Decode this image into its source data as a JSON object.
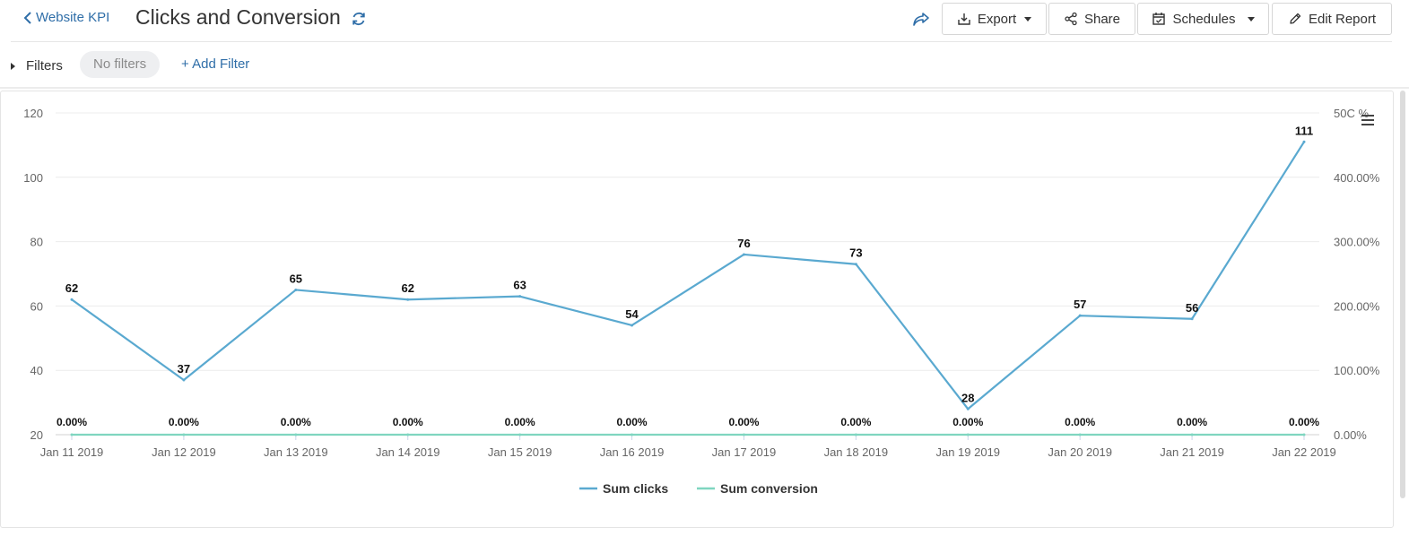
{
  "header": {
    "back_label": "Website KPI",
    "title": "Clicks and Conversion",
    "buttons": {
      "export": "Export",
      "share": "Share",
      "schedules": "Schedules",
      "edit_report": "Edit Report"
    }
  },
  "filters": {
    "label": "Filters",
    "no_filters": "No filters",
    "add_filter": "+ Add Filter"
  },
  "icons": [
    "chevron-left-icon",
    "refresh-icon",
    "share-arrow-icon",
    "export-icon",
    "share-icon",
    "calendar-icon",
    "pencil-icon",
    "menu-icon"
  ],
  "colors": {
    "link": "#2f6ea8",
    "clicks_line": "#5aa9d0",
    "conversion_line": "#7fd6c0"
  },
  "chart_data": {
    "type": "line",
    "categories": [
      "Jan 11 2019",
      "Jan 12 2019",
      "Jan 13 2019",
      "Jan 14 2019",
      "Jan 15 2019",
      "Jan 16 2019",
      "Jan 17 2019",
      "Jan 18 2019",
      "Jan 19 2019",
      "Jan 20 2019",
      "Jan 21 2019",
      "Jan 22 2019"
    ],
    "series": [
      {
        "name": "Sum clicks",
        "axis": "left",
        "values": [
          62,
          37,
          65,
          62,
          63,
          54,
          76,
          73,
          28,
          57,
          56,
          111
        ],
        "labels": [
          "62",
          "37",
          "65",
          "62",
          "63",
          "54",
          "76",
          "73",
          "28",
          "57",
          "56",
          "111"
        ]
      },
      {
        "name": "Sum conversion",
        "axis": "right",
        "values": [
          0,
          0,
          0,
          0,
          0,
          0,
          0,
          0,
          0,
          0,
          0,
          0
        ],
        "labels": [
          "0.00%",
          "0.00%",
          "0.00%",
          "0.00%",
          "0.00%",
          "0.00%",
          "0.00%",
          "0.00%",
          "0.00%",
          "0.00%",
          "0.00%",
          "0.00%"
        ]
      }
    ],
    "ylim": [
      20,
      120
    ],
    "yticks": [
      "120",
      "100",
      "80",
      "60",
      "40",
      "20"
    ],
    "y2lim": [
      0,
      500
    ],
    "y2ticks": [
      "50C %",
      "400.00%",
      "300.00%",
      "200.00%",
      "100.00%",
      "0.00%"
    ],
    "grid": true,
    "legend": "bottom-center"
  }
}
